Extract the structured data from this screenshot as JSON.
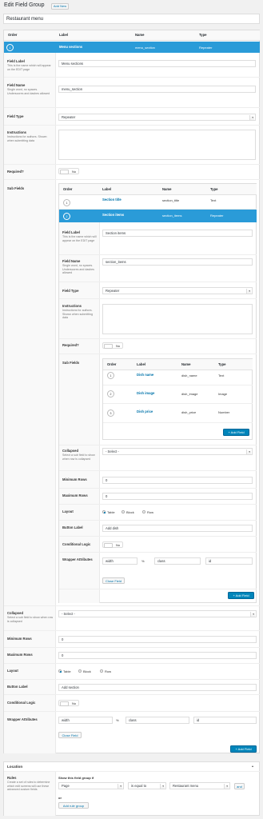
{
  "header": {
    "title": "Edit Field Group",
    "add_new": "Add New"
  },
  "group_title": "Restaurant menu",
  "fields_table": {
    "col_order": "Order",
    "col_label": "Label",
    "col_name": "Name",
    "col_type": "Type"
  },
  "f1": {
    "order": "1",
    "label": "Menu sections",
    "name": "menu_section",
    "type": "Repeater",
    "field_label_title": "Field Label",
    "field_label_desc": "This is the name which will appear on the EDIT page",
    "field_label_value": "Menu sections",
    "field_name_title": "Field Name",
    "field_name_desc": "Single word, no spaces. Underscores and dashes allowed",
    "field_name_value": "menu_section",
    "field_type_title": "Field Type",
    "field_type_value": "Repeater",
    "instructions_title": "Instructions",
    "instructions_desc": "Instructions for authors. Shown when submitting data",
    "required_title": "Required?",
    "required_value": "No",
    "sub_fields_title": "Sub Fields",
    "collapsed_title": "Collapsed",
    "collapsed_desc": "Select a sub field to show when row is collapsed",
    "collapsed_value": "- Select -",
    "min_rows_title": "Minimum Rows",
    "min_rows_value": "0",
    "max_rows_title": "Maximum Rows",
    "max_rows_value": "0",
    "layout_title": "Layout",
    "layout_options": [
      "Table",
      "Block",
      "Row"
    ],
    "button_label_title": "Button Label",
    "button_label_value": "Add section",
    "cond_logic_title": "Conditional Logic",
    "cond_logic_value": "No",
    "wrapper_title": "Wrapper Attributes",
    "wrapper_width": "width",
    "wrapper_pct": "%",
    "wrapper_class": "class",
    "wrapper_id": "id",
    "close_field": "Close Field"
  },
  "s1": {
    "col_order": "Order",
    "col_label": "Label",
    "col_name": "Name",
    "col_type": "Type",
    "r1_order": "1",
    "r1_label": "Section title",
    "r1_name": "section_title",
    "r1_type": "Text",
    "r2_order": "2",
    "r2_label": "Section items",
    "r2_name": "section_items",
    "r2_type": "Repeater",
    "field_label_title": "Field Label",
    "field_label_desc": "This is the name which will appear on the EDIT page",
    "field_label_value": "Section items",
    "field_name_title": "Field Name",
    "field_name_desc": "Single word, no spaces. Underscores and dashes allowed",
    "field_name_value": "section_items",
    "field_type_title": "Field Type",
    "field_type_value": "Repeater",
    "instructions_title": "Instructions",
    "instructions_desc": "Instructions for authors. Shown when submitting data",
    "required_title": "Required?",
    "required_value": "No",
    "sub_fields_title": "Sub Fields",
    "collapsed_title": "Collapsed",
    "collapsed_desc": "Select a sub field to show when row is collapsed",
    "collapsed_value": "- Select -",
    "min_rows_title": "Minimum Rows",
    "min_rows_value": "0",
    "max_rows_title": "Maximum Rows",
    "max_rows_value": "0",
    "layout_title": "Layout",
    "layout_options": [
      "Table",
      "Block",
      "Row"
    ],
    "button_label_title": "Button Label",
    "button_label_value": "Add dish",
    "cond_logic_title": "Conditional Logic",
    "cond_logic_value": "No",
    "wrapper_title": "Wrapper Attributes",
    "wrapper_width": "width",
    "wrapper_pct": "%",
    "wrapper_class": "class",
    "wrapper_id": "id",
    "close_field": "Close Field",
    "add_field": "+ Add Field"
  },
  "s2": {
    "col_order": "Order",
    "col_label": "Label",
    "col_name": "Name",
    "col_type": "Type",
    "r1_order": "1",
    "r1_label": "Dish name",
    "r1_name": "dish_name",
    "r1_type": "Text",
    "r2_order": "2",
    "r2_label": "Dish image",
    "r2_name": "dish_image",
    "r2_type": "Image",
    "r3_order": "3",
    "r3_label": "Dish price",
    "r3_name": "dish_price",
    "r3_type": "Number",
    "add_field": "+ Add Field"
  },
  "add_field_main": "+ Add Field",
  "location": {
    "title": "Location",
    "rules_title": "Rules",
    "rules_desc": "Create a set of rules to determine which edit screens will use these advanced custom fields",
    "show_if": "Show this field group if",
    "param": "Page",
    "operator": "is equal to",
    "value": "Restaurant menu",
    "and": "and",
    "or": "or",
    "add_rule_group": "Add rule group"
  }
}
